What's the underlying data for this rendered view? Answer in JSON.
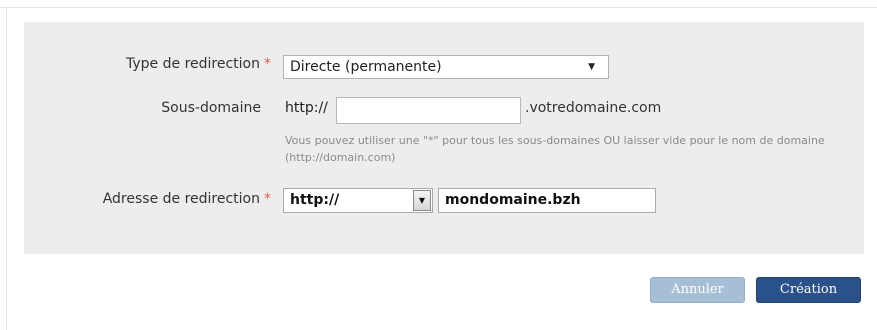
{
  "form": {
    "redirect_type": {
      "label": "Type de redirection",
      "required_mark": "*",
      "value": "Directe (permanente)"
    },
    "subdomain": {
      "label": "Sous-domaine",
      "prefix": "http://",
      "value": "",
      "suffix": ".votredomaine.com",
      "help": "Vous pouvez utiliser une \"*\" pour tous les sous-domaines OU laisser vide pour le nom de domaine (http://domain.com)"
    },
    "redirect_address": {
      "label": "Adresse de redirection",
      "required_mark": "*",
      "protocol": "http://",
      "value": "mondomaine.bzh"
    }
  },
  "actions": {
    "cancel_label": "Annuler",
    "create_label": "Création"
  },
  "icons": {
    "select_arrow": "dropdown-triangle-icon",
    "protocol_arrow": "dropdown-triangle-icon"
  },
  "colors": {
    "panel_bg": "#ededec",
    "required": "#e25b4d",
    "primary_button": "#2a5189",
    "secondary_button": "#a6bfd7"
  }
}
